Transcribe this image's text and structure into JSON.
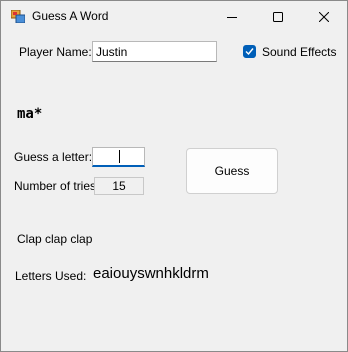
{
  "window": {
    "title": "Guess A Word",
    "icon": "app-icon"
  },
  "player": {
    "label": "Player Name:",
    "value": "Justin"
  },
  "sound": {
    "label": "Sound Effects",
    "checked": true
  },
  "word": {
    "pattern": "ma*"
  },
  "guess": {
    "label": "Guess a letter:",
    "value": ""
  },
  "tries": {
    "label": "Number of tries:",
    "value": "15"
  },
  "guess_button": {
    "label": "Guess"
  },
  "message": {
    "text": "Clap clap clap"
  },
  "letters": {
    "label": "Letters Used:",
    "value": "eaiouyswnhkldrm"
  },
  "colors": {
    "accent": "#005fb8",
    "window_bg": "#f0f0f0"
  }
}
